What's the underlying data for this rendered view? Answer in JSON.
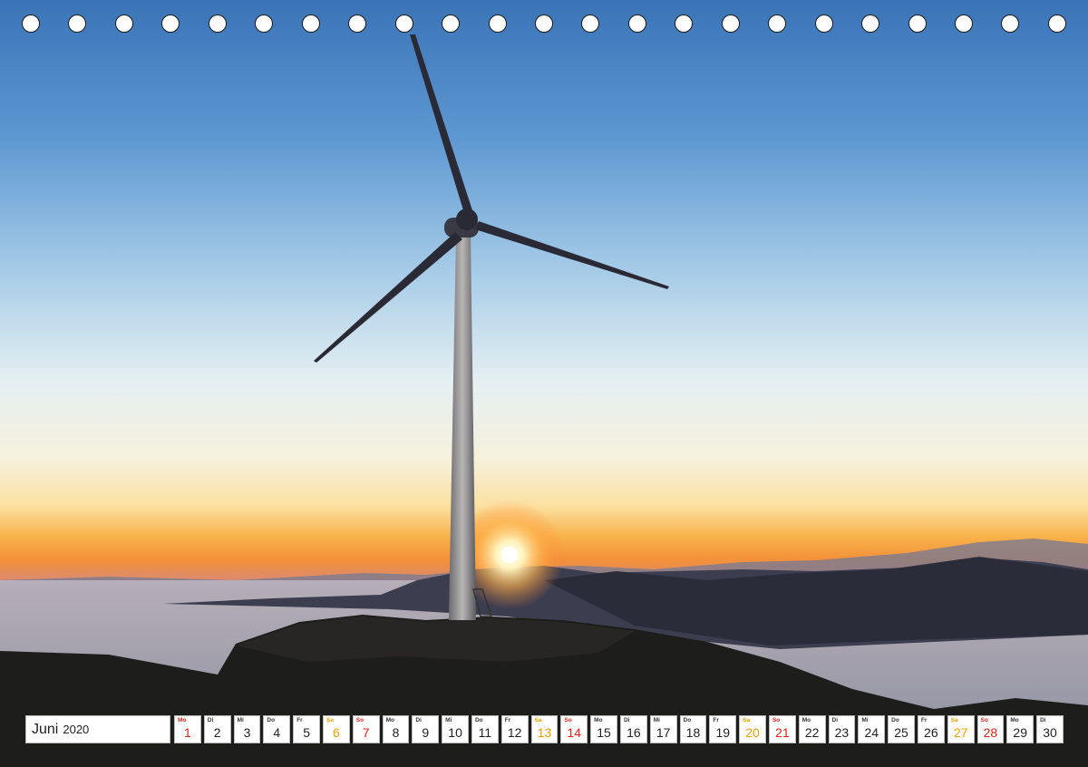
{
  "calendar": {
    "month": "Juni",
    "year": "2020",
    "days": [
      {
        "wd": "Mo",
        "num": "1",
        "type": "hol"
      },
      {
        "wd": "Di",
        "num": "2",
        "type": ""
      },
      {
        "wd": "Mi",
        "num": "3",
        "type": ""
      },
      {
        "wd": "Do",
        "num": "4",
        "type": ""
      },
      {
        "wd": "Fr",
        "num": "5",
        "type": ""
      },
      {
        "wd": "Sa",
        "num": "6",
        "type": "sat"
      },
      {
        "wd": "So",
        "num": "7",
        "type": "sun"
      },
      {
        "wd": "Mo",
        "num": "8",
        "type": ""
      },
      {
        "wd": "Di",
        "num": "9",
        "type": ""
      },
      {
        "wd": "Mi",
        "num": "10",
        "type": ""
      },
      {
        "wd": "Do",
        "num": "11",
        "type": ""
      },
      {
        "wd": "Fr",
        "num": "12",
        "type": ""
      },
      {
        "wd": "Sa",
        "num": "13",
        "type": "sat"
      },
      {
        "wd": "So",
        "num": "14",
        "type": "sun"
      },
      {
        "wd": "Mo",
        "num": "15",
        "type": ""
      },
      {
        "wd": "Di",
        "num": "16",
        "type": ""
      },
      {
        "wd": "Mi",
        "num": "17",
        "type": ""
      },
      {
        "wd": "Do",
        "num": "18",
        "type": ""
      },
      {
        "wd": "Fr",
        "num": "19",
        "type": ""
      },
      {
        "wd": "Sa",
        "num": "20",
        "type": "sat"
      },
      {
        "wd": "So",
        "num": "21",
        "type": "sun"
      },
      {
        "wd": "Mo",
        "num": "22",
        "type": ""
      },
      {
        "wd": "Di",
        "num": "23",
        "type": ""
      },
      {
        "wd": "Mi",
        "num": "24",
        "type": ""
      },
      {
        "wd": "Do",
        "num": "25",
        "type": ""
      },
      {
        "wd": "Fr",
        "num": "26",
        "type": ""
      },
      {
        "wd": "Sa",
        "num": "27",
        "type": "sat"
      },
      {
        "wd": "So",
        "num": "28",
        "type": "sun"
      },
      {
        "wd": "Mo",
        "num": "29",
        "type": ""
      },
      {
        "wd": "Di",
        "num": "30",
        "type": ""
      }
    ]
  },
  "binding_holes": 23,
  "colors": {
    "sky_top": "#3f7cc0",
    "horizon_glow": "#f59a2c",
    "saturday": "#f0a000",
    "sunday": "#e0231b"
  }
}
